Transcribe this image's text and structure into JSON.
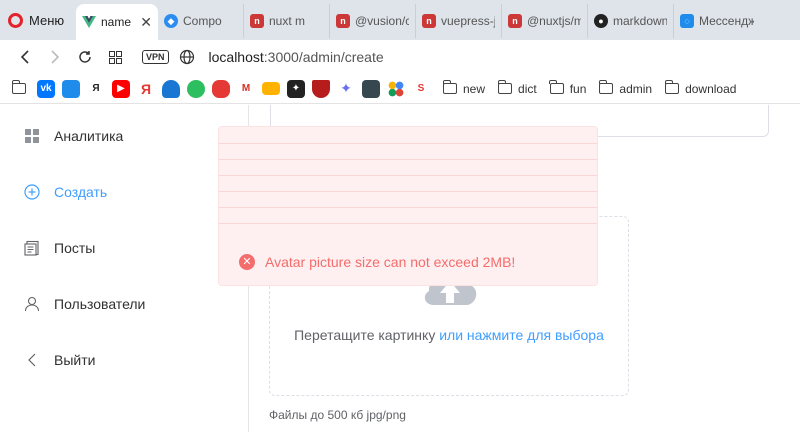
{
  "browser": {
    "menu_label": "Меню",
    "tabs": [
      {
        "label": "name",
        "icon": "vue-icon",
        "color": "#41b883",
        "active": true
      },
      {
        "label": "Compo",
        "icon": "component-icon",
        "color": "#2d8cf0"
      },
      {
        "label": "nuxt m",
        "icon": "npm-icon",
        "color": "#cb3837"
      },
      {
        "label": "@vusion/c",
        "icon": "npm-icon",
        "color": "#cb3837"
      },
      {
        "label": "vuepress-j",
        "icon": "npm-icon",
        "color": "#cb3837"
      },
      {
        "label": "@nuxtjs/m",
        "icon": "npm-icon",
        "color": "#cb3837"
      },
      {
        "label": "markdown",
        "icon": "github-icon",
        "color": "#222222"
      },
      {
        "label": "Мессендж",
        "icon": "messenger-icon",
        "color": "#1f8ceb"
      }
    ],
    "address": {
      "vpn_label": "VPN",
      "host": "localhost",
      "path": ":3000/admin/create"
    },
    "bookmarks": {
      "icons": [
        {
          "name": "vk-bookmark-icon",
          "text": "vk",
          "color": "#0077ff"
        },
        {
          "name": "chat-bookmark-icon",
          "text": "",
          "color": "#1f8ceb"
        },
        {
          "name": "yandex-bookmark-icon",
          "text": "Я",
          "color": "#ffffff"
        },
        {
          "name": "youtube-bookmark-icon",
          "text": "▶",
          "color": "#ff0000"
        },
        {
          "name": "yandex-red-bookmark-icon",
          "text": "Я",
          "color": "#ffffff"
        },
        {
          "name": "wave-bookmark-icon",
          "text": "",
          "color": "#1976d2"
        },
        {
          "name": "evernote-bookmark-icon",
          "text": "",
          "color": "#2dbe60"
        },
        {
          "name": "lantern-bookmark-icon",
          "text": "",
          "color": "#e53935"
        },
        {
          "name": "gmail-bookmark-icon",
          "text": "M",
          "color": "#ffffff"
        },
        {
          "name": "mail-bookmark-icon",
          "text": "",
          "color": "#ffb300"
        },
        {
          "name": "spark-bookmark-icon",
          "text": "✦",
          "color": "#222222"
        },
        {
          "name": "shield-bookmark-icon",
          "text": "",
          "color": "#b71c1c"
        },
        {
          "name": "gemini-bookmark-icon",
          "text": "✦",
          "color": "#ffffff"
        },
        {
          "name": "app-bookmark-icon",
          "text": "",
          "color": "#37474f"
        },
        {
          "name": "dots-bookmark-icon",
          "text": "",
          "color": "#ffffff"
        },
        {
          "name": "s-bookmark-icon",
          "text": "S",
          "color": "#ffffff"
        }
      ],
      "folders": [
        "new",
        "dict",
        "fun",
        "admin",
        "download"
      ]
    }
  },
  "sidebar": {
    "items": [
      {
        "label": "Аналитика",
        "icon": "dashboard-icon"
      },
      {
        "label": "Создать",
        "icon": "plus-circle-icon",
        "active": true
      },
      {
        "label": "Посты",
        "icon": "document-icon"
      },
      {
        "label": "Пользователи",
        "icon": "user-icon"
      },
      {
        "label": "Выйти",
        "icon": "chevron-left-icon"
      }
    ]
  },
  "upload": {
    "drop_text": "Перетащите картинку ",
    "drop_link": "или нажмите для выбора",
    "hint": "Файлы до 500 кб jpg/png"
  },
  "message": {
    "text": "Avatar picture size can not exceed 2MB!",
    "type": "error"
  },
  "colors": {
    "accent": "#409eff",
    "error": "#f56c6c",
    "error_bg": "#fef0f0"
  }
}
